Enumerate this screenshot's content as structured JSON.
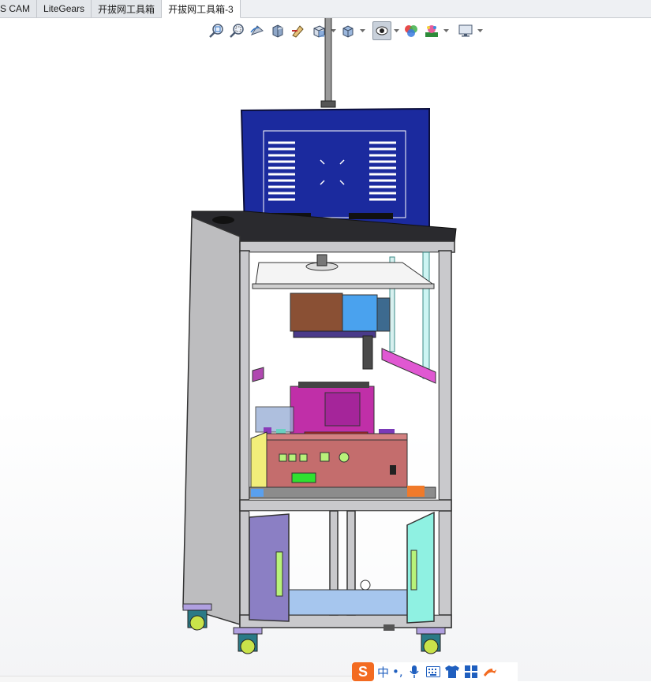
{
  "tabs": [
    {
      "label": "S CAM",
      "active": false
    },
    {
      "label": "LiteGears",
      "active": false
    },
    {
      "label": "开拔网工具箱",
      "active": false
    },
    {
      "label": "开拔网工具箱-3",
      "active": true
    }
  ],
  "toolbar": {
    "items": [
      "zoom-to-fit-icon",
      "zoom-to-area-icon",
      "previous-view-icon",
      "section-view-icon",
      "dynamic-annotation-icon",
      "view-orientation-icon",
      "display-style-icon",
      "hide-show-items-icon",
      "edit-appearance-icon",
      "apply-scene-icon",
      "view-settings-icon"
    ]
  },
  "ime": {
    "logo": "S",
    "mode": "中",
    "punct": "•,",
    "icons": [
      "microphone-icon",
      "keyboard-icon",
      "shirt-icon",
      "toolbox-icon",
      "skin-icon"
    ]
  },
  "colors": {
    "monitor": "#1b2a9e",
    "frame": "#c9c9cc",
    "side_panel": "#bdbdbf",
    "fixture_magenta": "#c02fa8",
    "control_box": "#c46d6d",
    "yellow_panel": "#f2ee7a",
    "door_left": "#8b7fc4",
    "door_right": "#8ff1e2",
    "caster_teal": "#2a7a86"
  }
}
